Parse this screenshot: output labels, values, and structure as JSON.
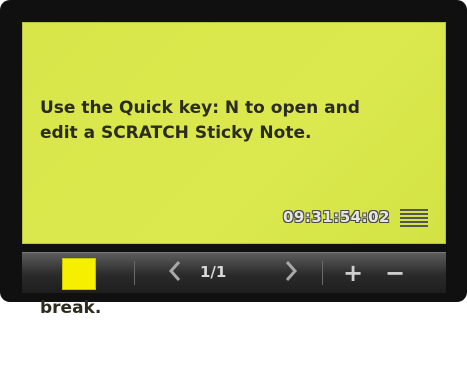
{
  "note": {
    "paragraphs": [
      "Use the Quick key: N to open and\nedit a SCRATCH Sticky Note.",
      "Use the \"Enter\" to force a line\nbreak."
    ],
    "timestamp": "09:31:54:02",
    "background_color": "#d8e64a"
  },
  "toolbar": {
    "color_swatch": "#f6f000",
    "prev_icon": "chevron-left-icon",
    "page_indicator": "1/1",
    "next_icon": "chevron-right-icon",
    "add_label": "+",
    "remove_label": "−",
    "menu_icon": "hamburger-icon"
  }
}
